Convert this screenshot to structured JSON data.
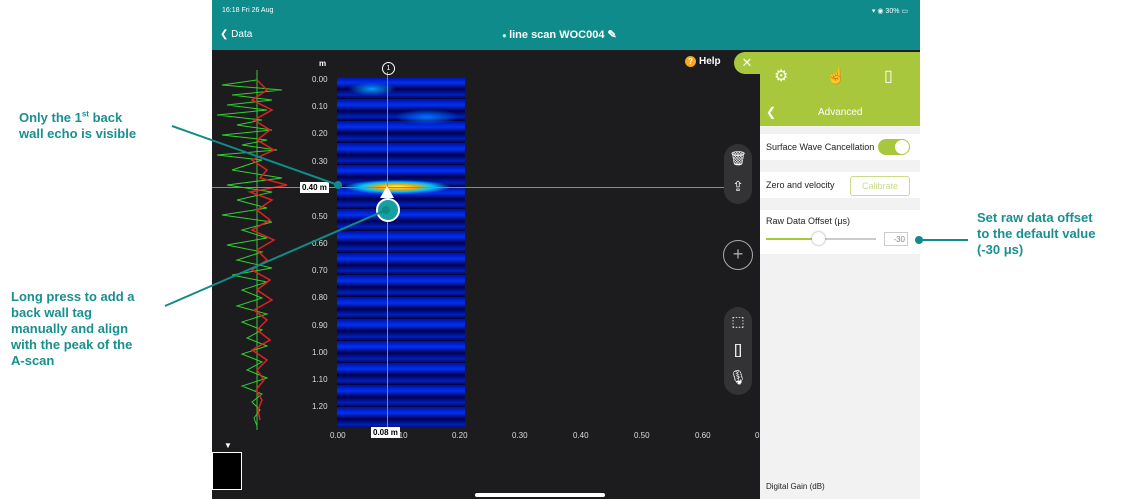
{
  "annotations": {
    "back_wall_pre": "Only the 1",
    "back_wall_sup": "st",
    "back_wall_post": " back",
    "back_wall_line2": "wall echo is visible",
    "long_press": [
      "Long press to add a",
      "back wall tag",
      "manually and align",
      "with the peak of the",
      "A-scan"
    ],
    "raw_offset": [
      "Set raw data offset",
      "to the default value",
      "(-30 μs)"
    ]
  },
  "status_bar": {
    "time": "16:18  Fri 26 Aug",
    "battery": "30%"
  },
  "nav": {
    "back_label": "Data",
    "title": "line scan WOC004",
    "help_label": "Help"
  },
  "scan": {
    "y_unit": "m",
    "y_ticks": [
      "0.00",
      "0.10",
      "0.20",
      "0.30",
      "0.40 m",
      "0.50",
      "0.60",
      "0.70",
      "0.80",
      "0.90",
      "1.00",
      "1.10",
      "1.20"
    ],
    "x_ticks": [
      "0.00",
      "0.10",
      "0.20",
      "0.30",
      "0.40",
      "0.50",
      "0.60",
      "0"
    ],
    "channel": "1",
    "depth_value": "0.40 m",
    "position_value": "0.08 m"
  },
  "panel": {
    "header": "Advanced",
    "surface_wave": "Surface Wave Cancellation",
    "surface_wave_on": true,
    "zero_velocity": "Zero and velocity",
    "calibrate": "Calibrate",
    "raw_offset_label": "Raw Data Offset (μs)",
    "raw_offset_value": "-30",
    "digital_gain": "Digital Gain (dB)"
  },
  "icons": [
    "chevron-left-icon",
    "pencil-icon",
    "help-icon",
    "close-icon",
    "gear-icon",
    "hand-icon",
    "panel-icon",
    "trash-icon",
    "share-icon",
    "plus-icon",
    "select-icon",
    "split-icon",
    "microphone-icon"
  ],
  "colors": {
    "teal": "#0f8b8b",
    "lime": "#a8c73c",
    "annotation": "#1a8f8f"
  }
}
